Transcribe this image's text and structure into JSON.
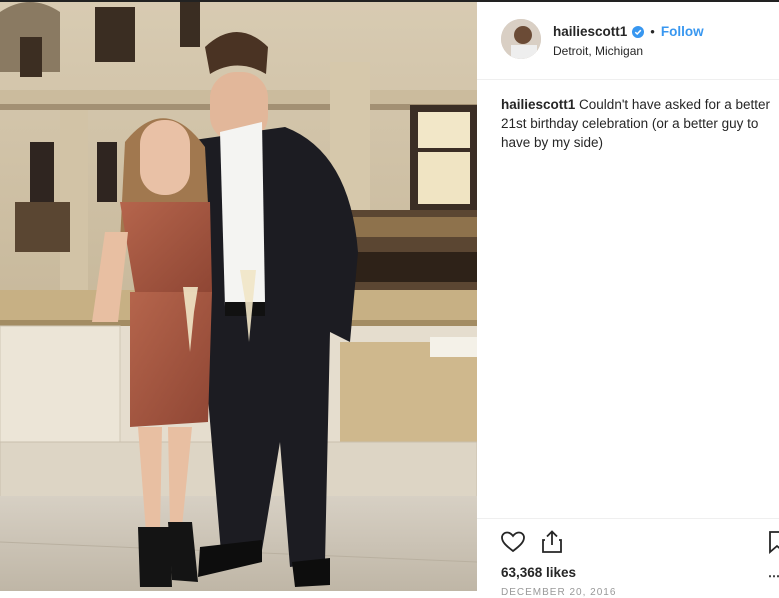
{
  "post": {
    "username": "hailiescott1",
    "location": "Detroit, Michigan",
    "follow_label": "Follow",
    "separator": "•",
    "caption": "Couldn't have asked for a better 21st birthday celebration (or a better guy to have by my side)",
    "likes": "63,368 likes",
    "date_partial": "DECEMBER 20, 2016"
  },
  "icons": {
    "verified": "verified-badge-icon",
    "like": "heart-icon",
    "share": "share-icon",
    "save": "bookmark-icon",
    "more": "more-options-icon"
  },
  "colors": {
    "accent": "#3897f0",
    "text": "#262626",
    "divider": "#efefef"
  }
}
